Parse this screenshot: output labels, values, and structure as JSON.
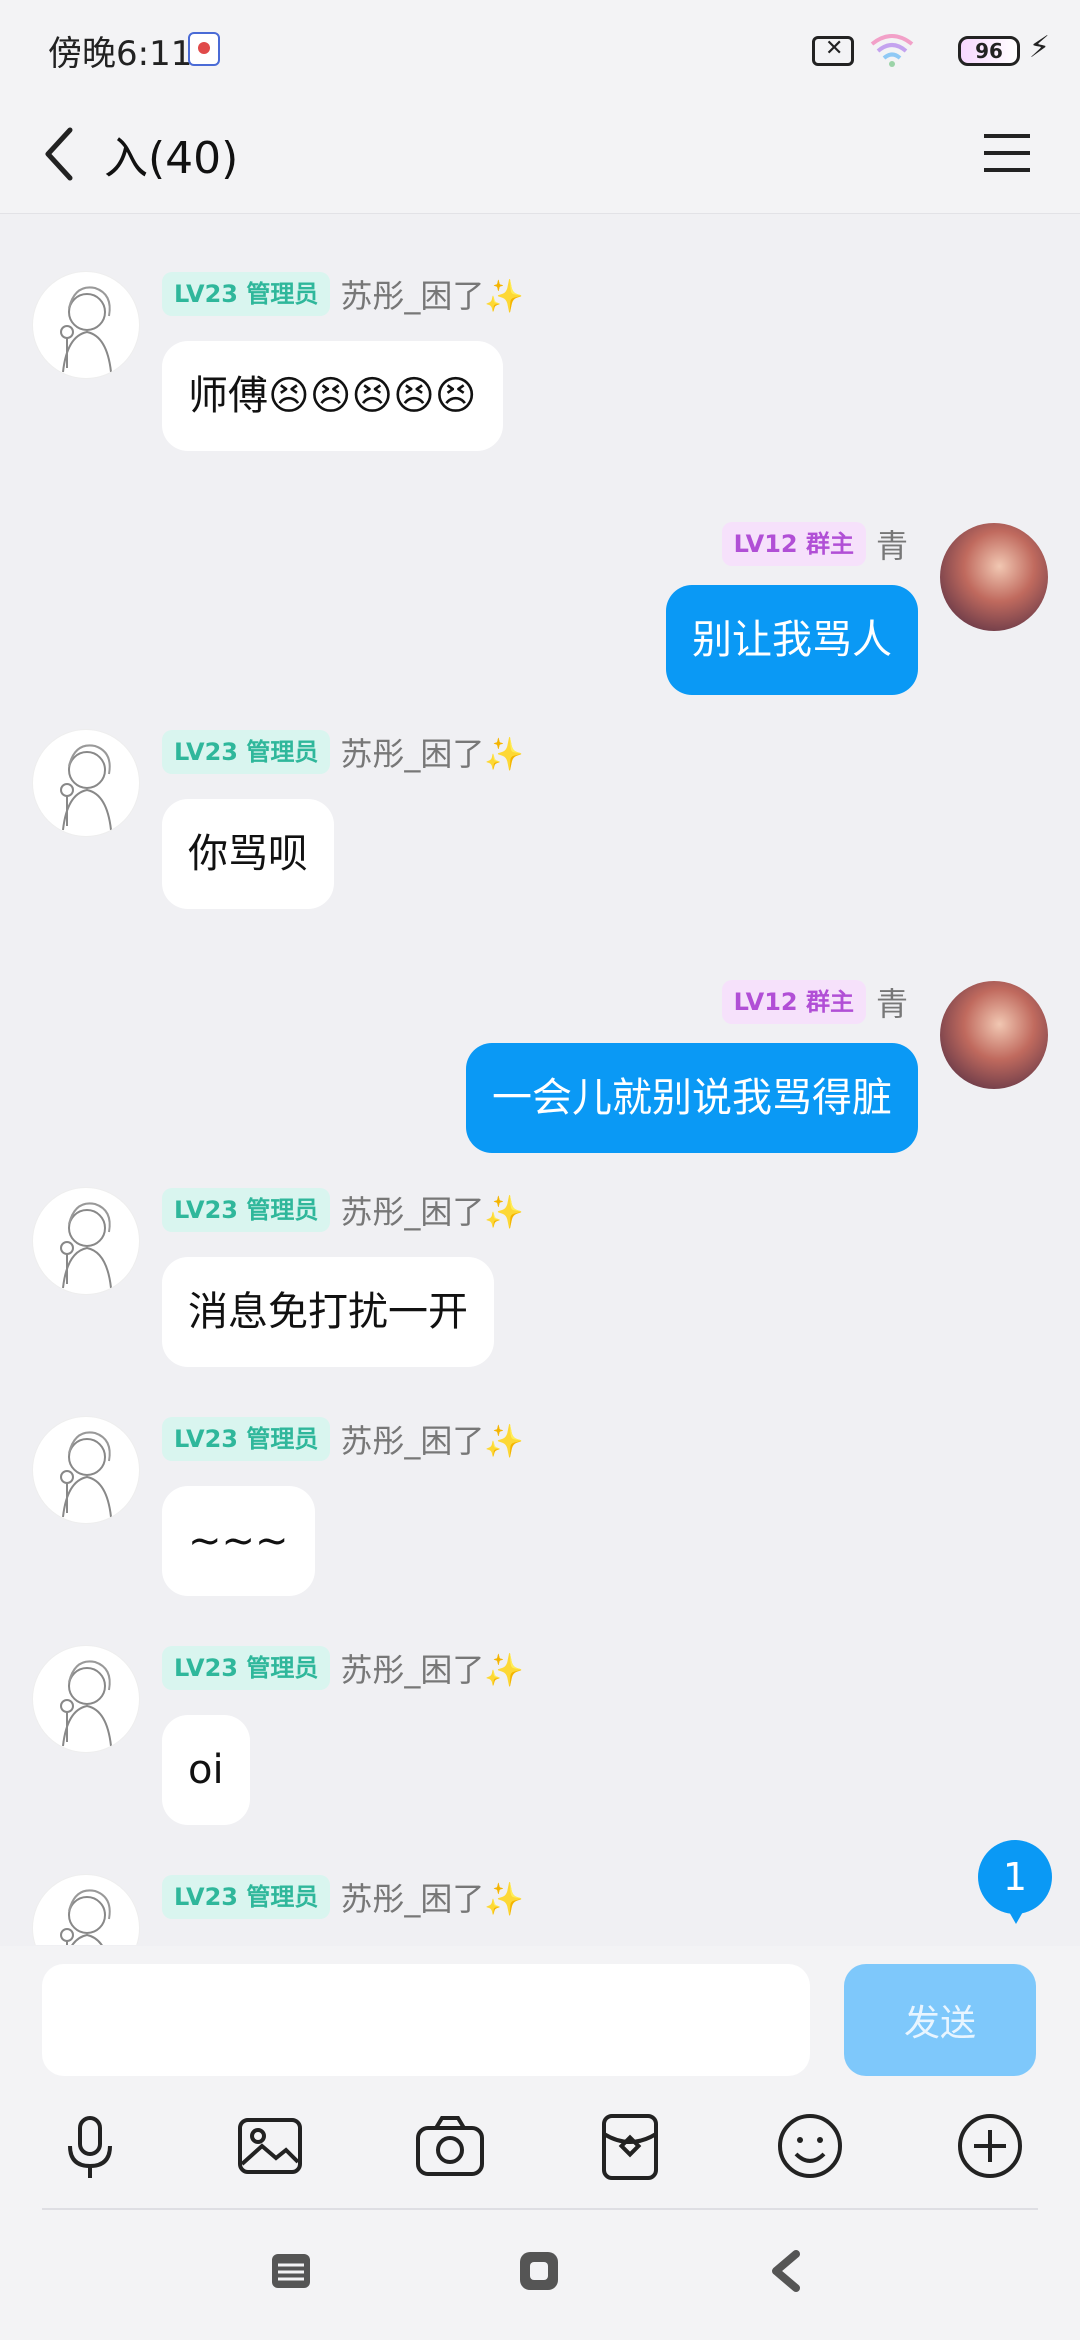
{
  "status_bar": {
    "time": "傍晚6:11",
    "battery": "96"
  },
  "header": {
    "title": "入(40)"
  },
  "messages": [
    {
      "side": "in",
      "level": "LV23 管理员",
      "sender": "苏彤_困了✨",
      "text": "师傅😣😣😣😣😣"
    },
    {
      "side": "out",
      "level": "LV12 群主",
      "sender": "青",
      "text": "别让我骂人"
    },
    {
      "side": "in",
      "level": "LV23 管理员",
      "sender": "苏彤_困了✨",
      "text": "你骂呗"
    },
    {
      "side": "out",
      "level": "LV12 群主",
      "sender": "青",
      "text": "一会儿就别说我骂得脏"
    },
    {
      "side": "in",
      "level": "LV23 管理员",
      "sender": "苏彤_困了✨",
      "text": "消息免打扰一开"
    },
    {
      "side": "in",
      "level": "LV23 管理员",
      "sender": "苏彤_困了✨",
      "text": "~~~"
    },
    {
      "side": "in",
      "level": "LV23 管理员",
      "sender": "苏彤_困了✨",
      "text": "oi"
    },
    {
      "side": "in",
      "level": "LV23 管理员",
      "sender": "苏彤_困了✨",
      "text": ""
    }
  ],
  "unread_count": "1",
  "composer": {
    "send_label": "发送",
    "placeholder": ""
  },
  "toolbar": [
    "microphone-icon",
    "image-icon",
    "camera-icon",
    "red-packet-icon",
    "emoji-icon",
    "plus-icon"
  ],
  "colors": {
    "accent": "#0a99f5",
    "send_disabled": "#7ec8fb",
    "admin_badge": "#2fb79b",
    "owner_badge": "#b14fd6"
  }
}
